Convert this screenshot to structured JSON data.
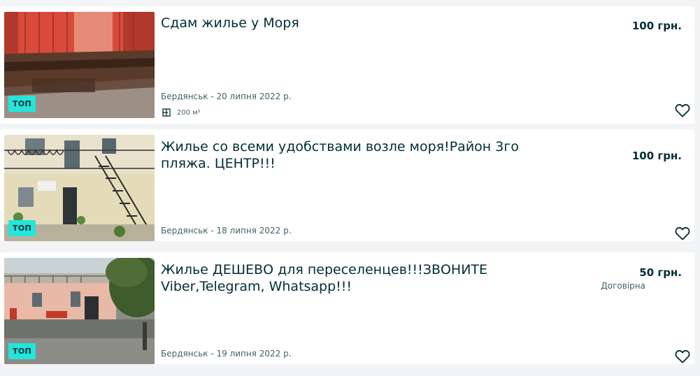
{
  "listings": [
    {
      "title": "Сдам жилье у Моря",
      "price": "100 грн.",
      "negotiable": "",
      "location_date": "Бердянськ - 20 липня 2022 р.",
      "area": "200 м²",
      "badge": "ТОП",
      "area_icon": "floorplan-icon",
      "fav_icon": "heart-outline-icon"
    },
    {
      "title": "Жилье со всеми удобствами возле моря!Район 3го пляжа. ЦЕНТР!!!",
      "price": "100 грн.",
      "negotiable": "",
      "location_date": "Бердянськ - 18 липня 2022 р.",
      "area": "",
      "badge": "ТОП",
      "fav_icon": "heart-outline-icon"
    },
    {
      "title": "Жилье ДЕШЕВО для переселенцев!!!ЗВОНИТЕ Viber,Telegram, Whatsapp!!!",
      "price": "50 грн.",
      "negotiable": "Договірна",
      "location_date": "Бердянськ - 19 липня 2022 р.",
      "area": "",
      "badge": "ТОП",
      "fav_icon": "heart-outline-icon"
    }
  ],
  "colors": {
    "background": "#f2f4f5",
    "card": "#ffffff",
    "text_primary": "#002f34",
    "text_secondary": "#406367",
    "badge": "#23e5db"
  }
}
